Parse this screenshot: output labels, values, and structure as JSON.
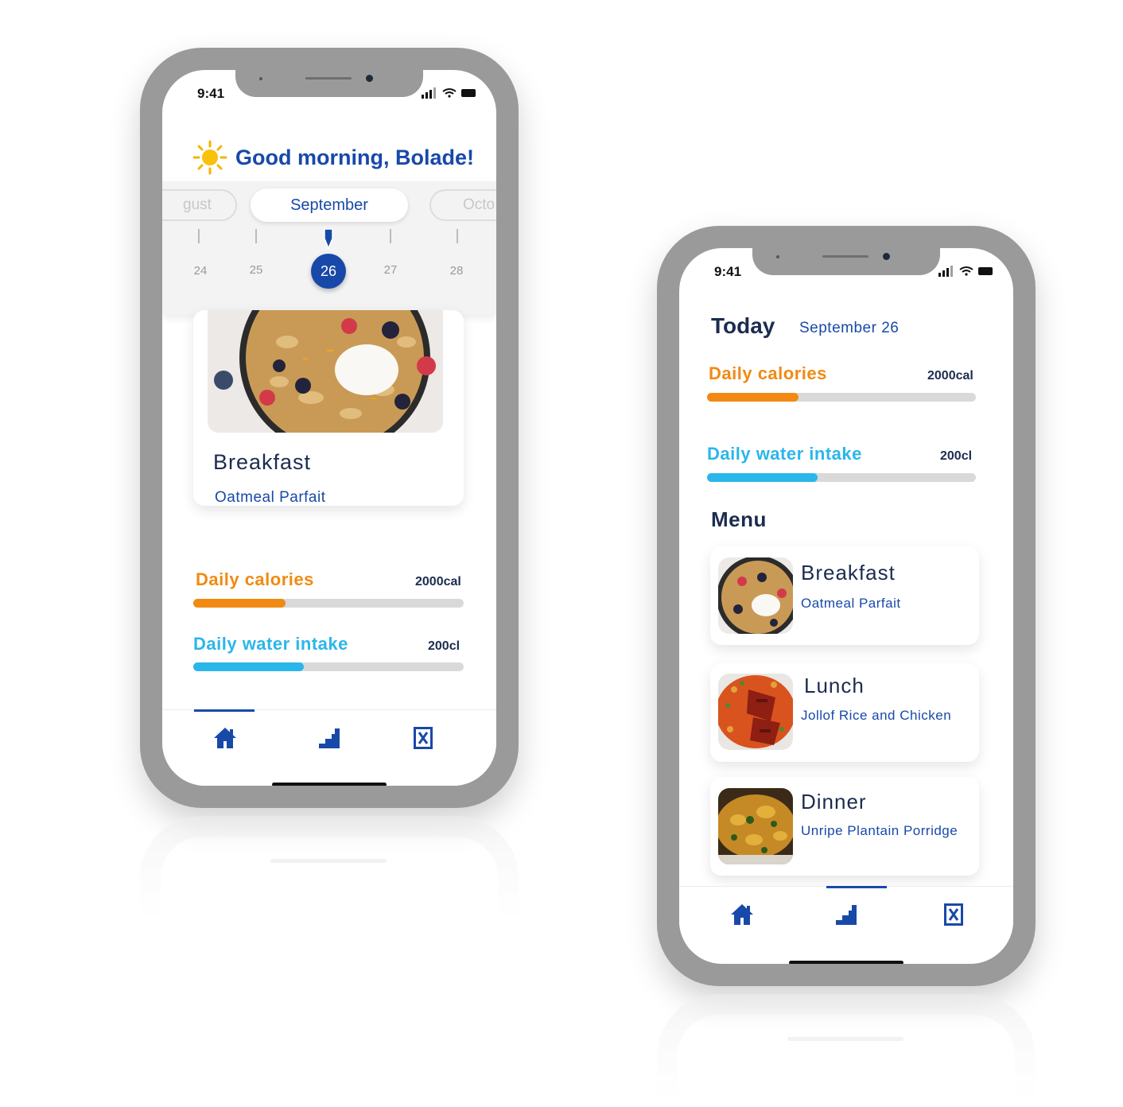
{
  "colors": {
    "brand_blue": "#1849a9",
    "calories_orange": "#f08a12",
    "water_blue": "#2bb6ea",
    "track_gray": "#d9d9d9",
    "device_gray": "#9a9a9a"
  },
  "phone_left": {
    "status_time": "9:41",
    "greeting": "Good morning, Bolade!",
    "greeting_icon": "sun-icon",
    "months": {
      "prev": "gust",
      "current": "September",
      "next": "Octo"
    },
    "days": [
      "24",
      "25",
      "26",
      "27",
      "28"
    ],
    "selected_day": "26",
    "featured_meal": {
      "title": "Breakfast",
      "dish": "Oatmeal Parfait"
    },
    "calories": {
      "label": "Daily calories",
      "value": "2000cal",
      "progress": 0.34
    },
    "water": {
      "label": "Daily water intake",
      "value": "200cl",
      "progress": 0.41
    },
    "tabs": [
      {
        "name": "home",
        "icon": "home-icon",
        "active": true
      },
      {
        "name": "progress",
        "icon": "stairs-chart-icon",
        "active": false
      },
      {
        "name": "menu",
        "icon": "menu-book-icon",
        "active": false
      }
    ]
  },
  "phone_right": {
    "status_time": "9:41",
    "title": "Today",
    "date": "September 26",
    "calories": {
      "label": "Daily calories",
      "value": "2000cal",
      "progress": 0.34
    },
    "water": {
      "label": "Daily water intake",
      "value": "200cl",
      "progress": 0.41
    },
    "menu_heading": "Menu",
    "meals": [
      {
        "title": "Breakfast",
        "dish": "Oatmeal Parfait"
      },
      {
        "title": "Lunch",
        "dish": "Jollof Rice and Chicken"
      },
      {
        "title": "Dinner",
        "dish": "Unripe Plantain Porridge"
      }
    ],
    "tabs": [
      {
        "name": "home",
        "icon": "home-icon",
        "active": false
      },
      {
        "name": "progress",
        "icon": "stairs-chart-icon",
        "active": true
      },
      {
        "name": "menu",
        "icon": "menu-book-icon",
        "active": false
      }
    ]
  }
}
